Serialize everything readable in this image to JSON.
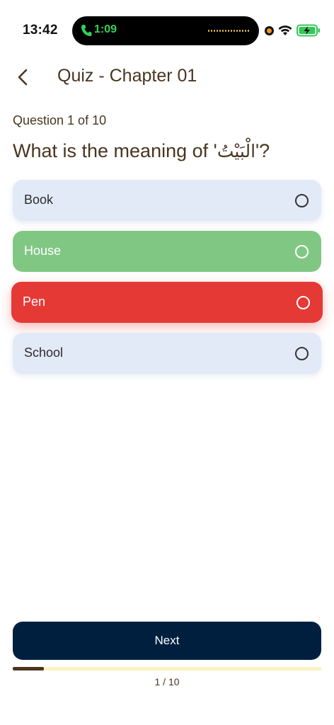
{
  "status_bar": {
    "time": "13:42",
    "call_time": "1:09",
    "call_icon": "phone-icon",
    "icons": [
      "recording-indicator",
      "wifi-icon",
      "battery-charging-icon"
    ]
  },
  "header": {
    "back_icon": "chevron-left-icon",
    "title": "Quiz - Chapter 01"
  },
  "question": {
    "counter": "Question 1 of 10",
    "prefix": "What is the meaning of '",
    "arabic": "الْبَيْتُ",
    "suffix": "'?"
  },
  "options": [
    {
      "label": "Book",
      "state": "default"
    },
    {
      "label": "House",
      "state": "correct"
    },
    {
      "label": "Pen",
      "state": "wrong"
    },
    {
      "label": "School",
      "state": "default"
    }
  ],
  "colors": {
    "default_option": "#e2eaf8",
    "correct_option": "#81c784",
    "wrong_option": "#e53935",
    "primary_button": "#001f3f",
    "text_brown": "#4a3520",
    "progress_track": "#fdf3c1"
  },
  "footer": {
    "next_label": "Next",
    "progress": 0.1,
    "progress_text": "1 / 10"
  }
}
